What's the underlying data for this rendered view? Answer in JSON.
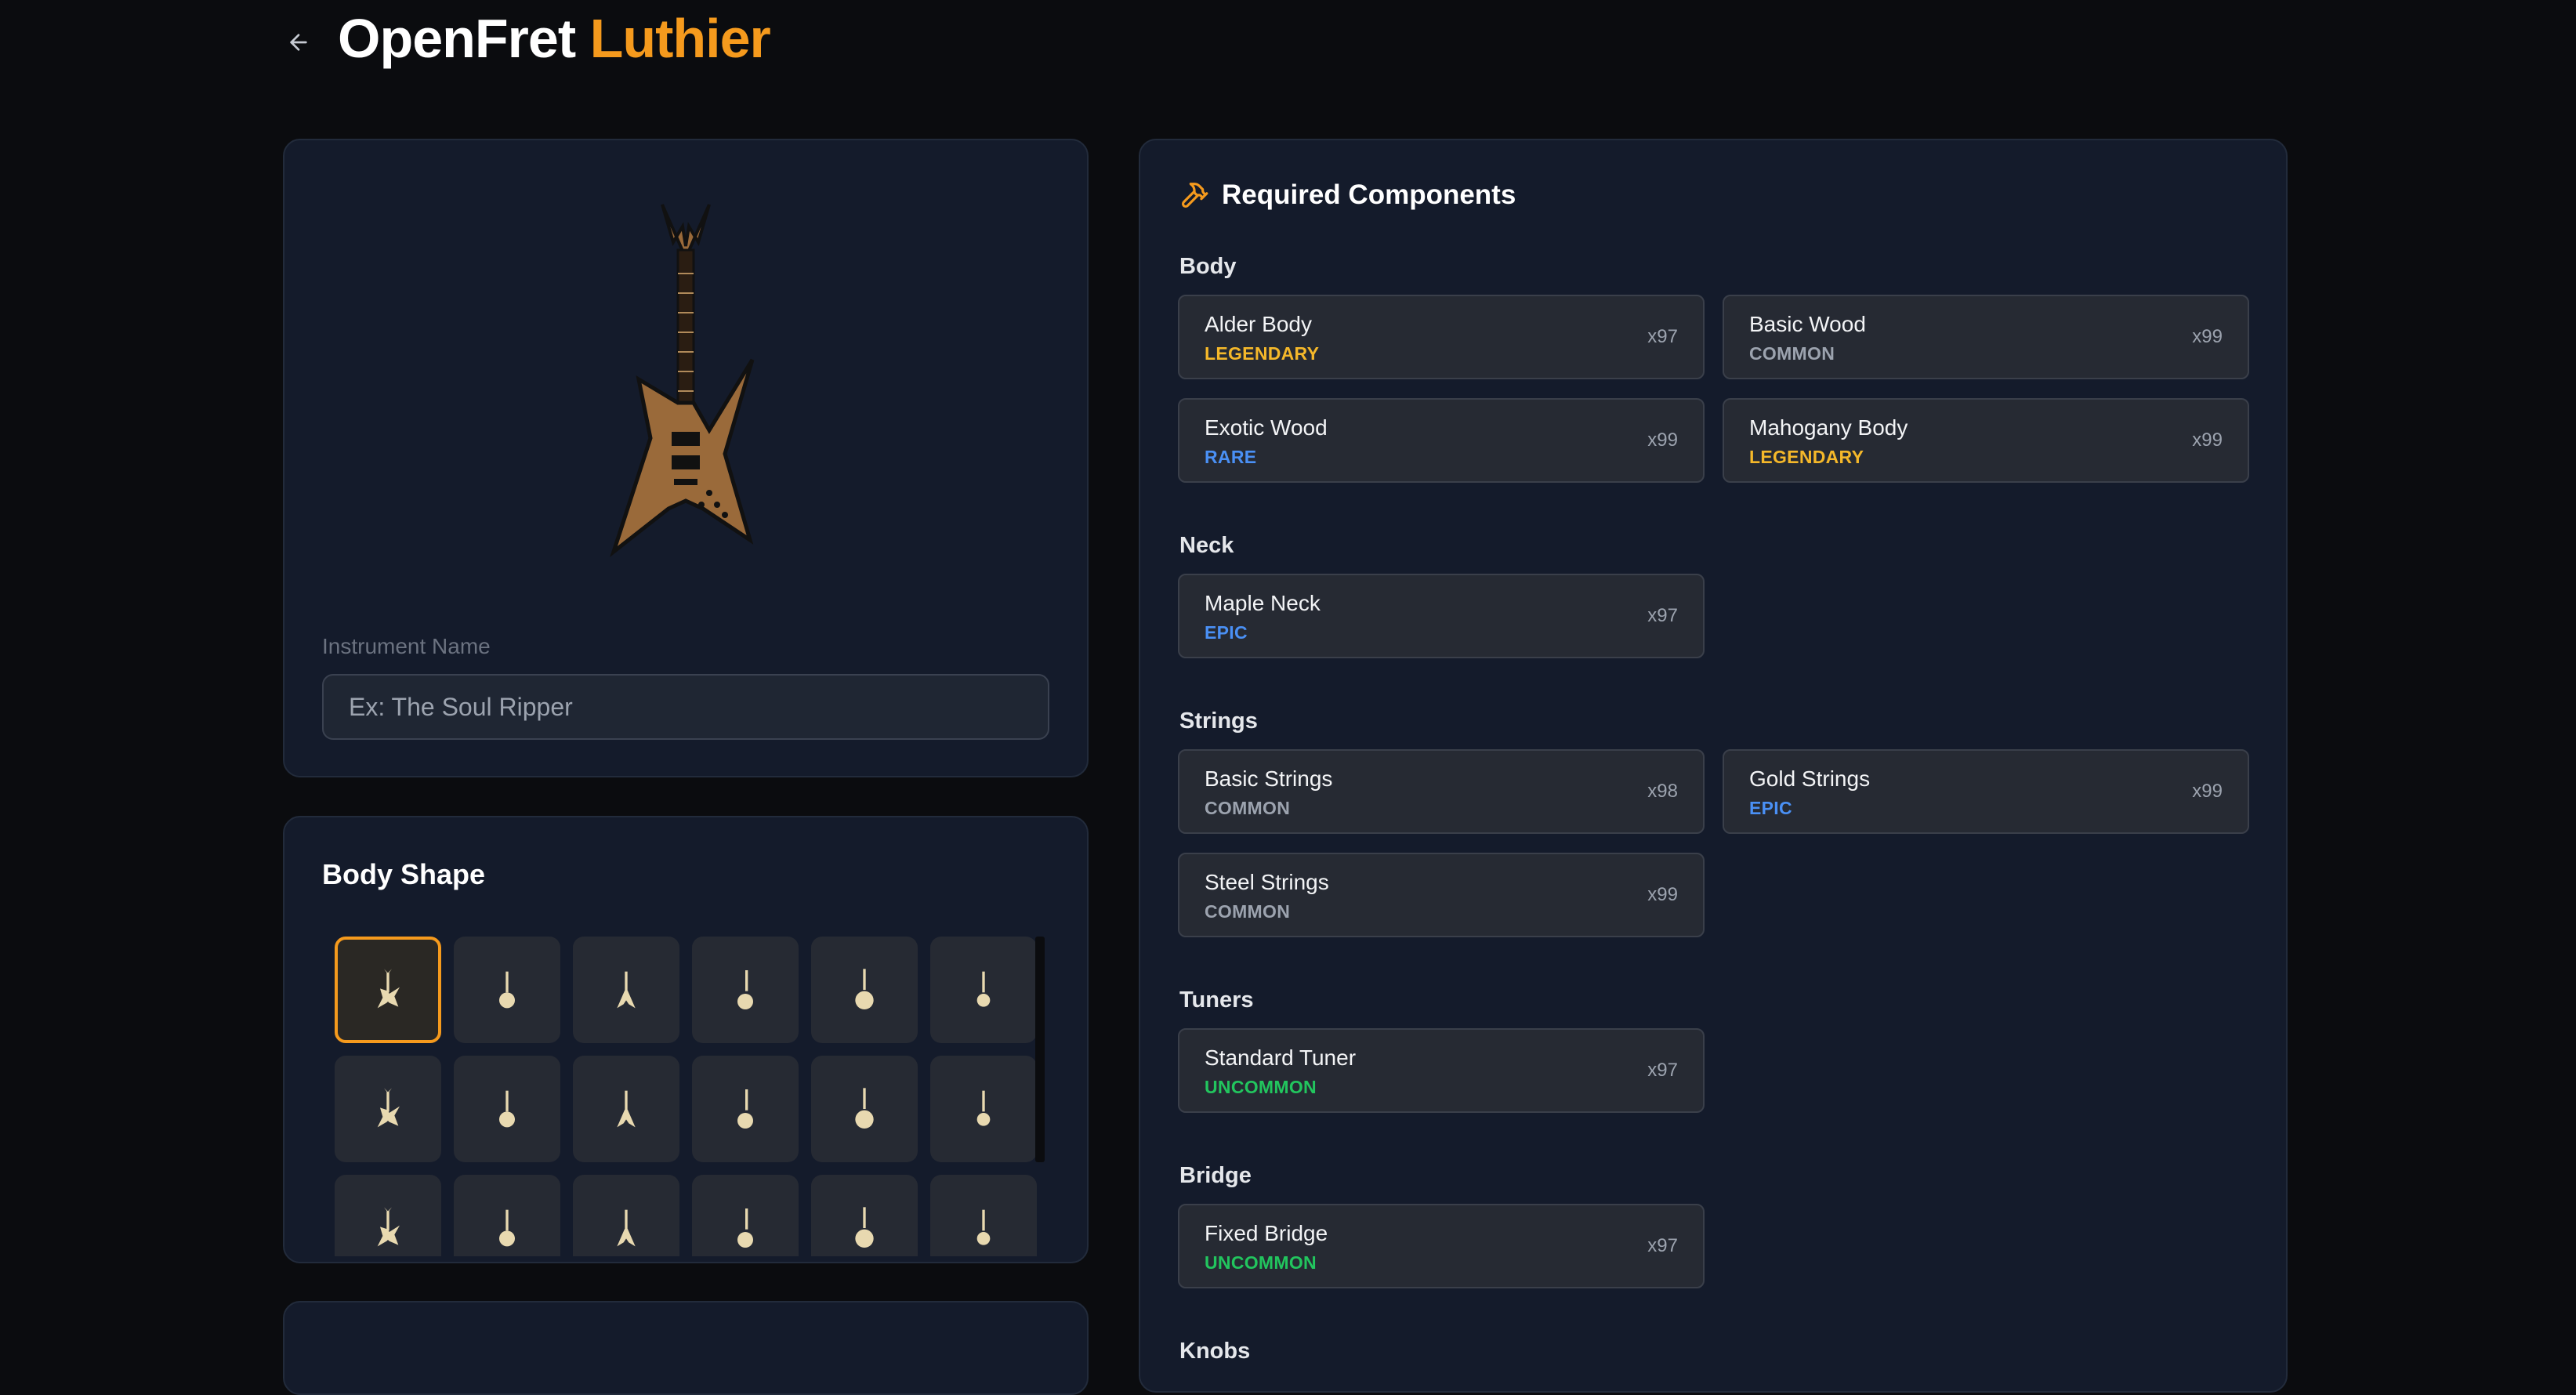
{
  "header": {
    "title_main": "OpenFret",
    "title_accent": "Luthier"
  },
  "preview": {
    "name_label": "Instrument Name",
    "name_placeholder": "Ex: The Soul Ripper",
    "name_value": ""
  },
  "body_shape": {
    "title": "Body Shape",
    "selected_index": 0
  },
  "components": {
    "title": "Required Components",
    "categories": [
      {
        "name": "Body",
        "items": [
          {
            "name": "Alder Body",
            "rarity": "LEGENDARY",
            "qty": "x97"
          },
          {
            "name": "Basic Wood",
            "rarity": "COMMON",
            "qty": "x99"
          },
          {
            "name": "Exotic Wood",
            "rarity": "RARE",
            "qty": "x99"
          },
          {
            "name": "Mahogany Body",
            "rarity": "LEGENDARY",
            "qty": "x99"
          }
        ]
      },
      {
        "name": "Neck",
        "items": [
          {
            "name": "Maple Neck",
            "rarity": "EPIC",
            "qty": "x97"
          }
        ]
      },
      {
        "name": "Strings",
        "items": [
          {
            "name": "Basic Strings",
            "rarity": "COMMON",
            "qty": "x98"
          },
          {
            "name": "Gold Strings",
            "rarity": "EPIC",
            "qty": "x99"
          },
          {
            "name": "Steel Strings",
            "rarity": "COMMON",
            "qty": "x99"
          }
        ]
      },
      {
        "name": "Tuners",
        "items": [
          {
            "name": "Standard Tuner",
            "rarity": "UNCOMMON",
            "qty": "x97"
          }
        ]
      },
      {
        "name": "Bridge",
        "items": [
          {
            "name": "Fixed Bridge",
            "rarity": "UNCOMMON",
            "qty": "x97"
          }
        ]
      },
      {
        "name": "Knobs",
        "items": []
      }
    ]
  },
  "colors": {
    "accent": "#f59a1d",
    "legendary": "#f5b82a",
    "common": "#9ca3af",
    "rare": "#4a90f5",
    "epic": "#4a90f5",
    "uncommon": "#22c55e"
  }
}
